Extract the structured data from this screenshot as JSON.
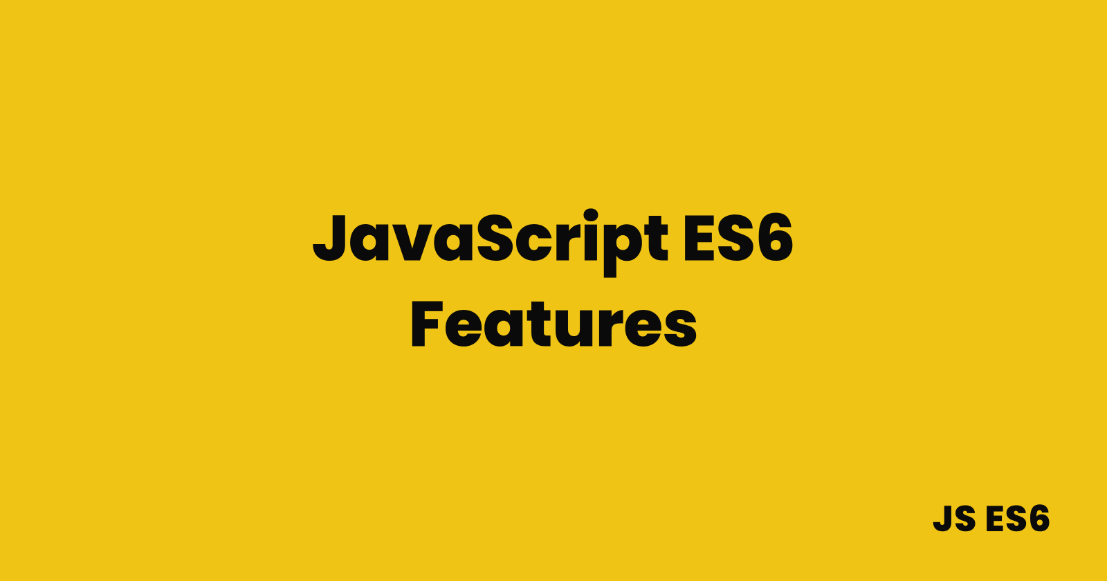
{
  "title": "JavaScript ES6\nFeatures",
  "footer": "JS ES6",
  "colors": {
    "background": "#f0c414",
    "text": "#0a0a0a"
  }
}
